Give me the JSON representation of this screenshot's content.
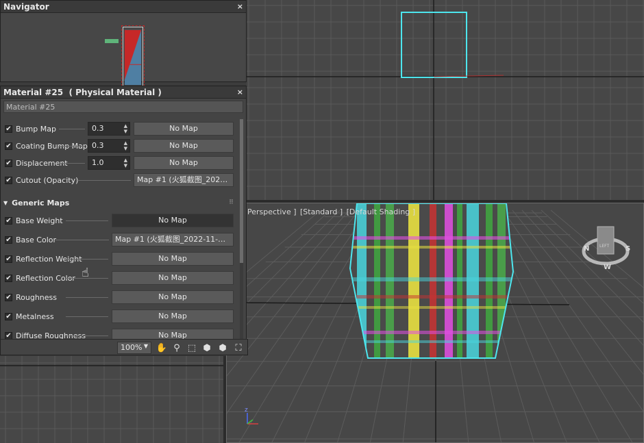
{
  "navigator": {
    "title": "Navigator",
    "close": "×"
  },
  "material": {
    "title": "Material #25  ( Physical Material )",
    "close": "×",
    "name_value": "Material #25",
    "special_maps": [
      {
        "label": "Bump Map",
        "amount": "0.3",
        "map": "No Map"
      },
      {
        "label": "Coating Bump Map",
        "amount": "0.3",
        "map": "No Map"
      },
      {
        "label": "Displacement",
        "amount": "1.0",
        "map": "No Map"
      },
      {
        "label": "Cutout (Opacity)",
        "map": "Map #1 (火狐截图_2022-1..."
      }
    ],
    "generic_section": "Generic Maps",
    "generic_maps": [
      {
        "label": "Base Weight",
        "map": "No Map"
      },
      {
        "label": "Base Color",
        "map": "Map #1 (火狐截图_2022-11-07T..."
      },
      {
        "label": "Reflection Weight",
        "map": "No Map"
      },
      {
        "label": "Reflection Color",
        "map": "No Map"
      },
      {
        "label": "Roughness",
        "map": "No Map"
      },
      {
        "label": "Metalness",
        "map": "No Map"
      },
      {
        "label": "Diffuse Roughness",
        "map": "No Map"
      }
    ]
  },
  "toolbar": {
    "zoom": "100%"
  },
  "viewport": {
    "persp_label_1": "Perspective ]",
    "persp_label_2": "[Standard ]",
    "persp_label_3": "[Default Shading ]",
    "axis_z": "z",
    "viewcube_face": "LEFT",
    "compass_n": "N",
    "compass_s": "S",
    "compass_w": "W"
  },
  "colors": {
    "panel_bg": "#444444",
    "viewport_bg": "#474747",
    "selection_cyan": "#4de6ee",
    "nav_red": "#c62828",
    "nav_blue": "#4f7fa3"
  }
}
